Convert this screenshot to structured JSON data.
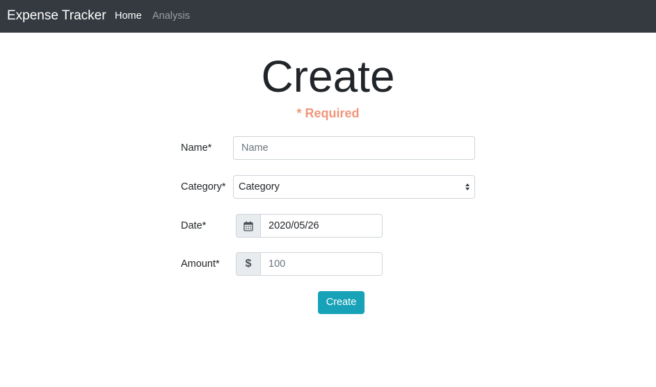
{
  "navbar": {
    "brand": "Expense Tracker",
    "links": [
      {
        "label": "Home",
        "active": true
      },
      {
        "label": "Analysis",
        "active": false
      }
    ]
  },
  "page": {
    "title": "Create",
    "required_note": "* Required"
  },
  "form": {
    "name": {
      "label": "Name*",
      "placeholder": "Name"
    },
    "category": {
      "label": "Category*",
      "selected": "Category"
    },
    "date": {
      "label": "Date*",
      "value": "2020/05/26",
      "icon": "calendar-icon"
    },
    "amount": {
      "label": "Amount*",
      "placeholder": "100",
      "icon": "dollar-icon"
    },
    "submit_label": "Create"
  },
  "colors": {
    "navbar_bg": "#343a40",
    "required_accent": "#f0957a",
    "button_bg": "#17a2b8"
  }
}
